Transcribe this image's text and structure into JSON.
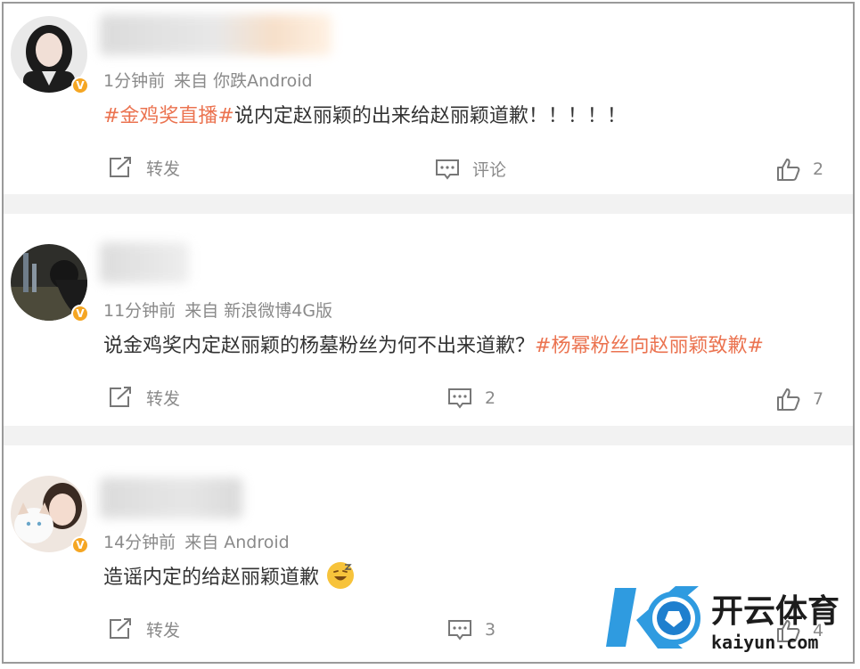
{
  "posts": [
    {
      "time": "1分钟前",
      "source": "来自 你跌Android",
      "text_parts": [
        {
          "type": "tag",
          "text": "#金鸡奖直播#"
        },
        {
          "type": "plain",
          "text": "说内定赵丽颖的出来给赵丽颖道歉！！！！！"
        }
      ],
      "repost_label": "转发",
      "comment_label": "评论",
      "like_count": "2"
    },
    {
      "time": "11分钟前",
      "source": "来自 新浪微博4G版",
      "text_parts": [
        {
          "type": "plain",
          "text": "说金鸡奖内定赵丽颖的杨墓粉丝为何不出来道歉？"
        },
        {
          "type": "tag",
          "text": "#杨幂粉丝向赵丽颖致歉#"
        }
      ],
      "repost_label": "转发",
      "comment_label": "2",
      "like_count": "7"
    },
    {
      "time": "14分钟前",
      "source": "来自 Android",
      "text_parts": [
        {
          "type": "plain",
          "text": "造谣内定的给赵丽颖道歉"
        }
      ],
      "repost_label": "转发",
      "comment_label": "3",
      "like_count": "4"
    }
  ],
  "badge_label": "V",
  "watermark": {
    "title": "开云体育",
    "domain": "kaiyun.com"
  },
  "colors": {
    "tag": "#eb7350",
    "meta": "#8a8a8a",
    "badge": "#f5a623",
    "separator": "#f2f2f2"
  }
}
